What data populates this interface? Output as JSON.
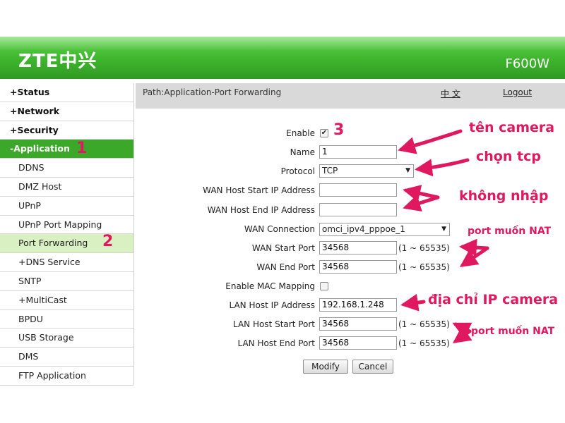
{
  "header": {
    "logo": "ZTE中兴",
    "model": "F600W"
  },
  "sidebar": {
    "items": [
      {
        "label": "+Status"
      },
      {
        "label": "+Network"
      },
      {
        "label": "+Security"
      },
      {
        "label": "-Application"
      },
      {
        "label": "DDNS"
      },
      {
        "label": "DMZ Host"
      },
      {
        "label": "UPnP"
      },
      {
        "label": "UPnP Port Mapping"
      },
      {
        "label": "Port Forwarding"
      },
      {
        "label": "+DNS Service"
      },
      {
        "label": "SNTP"
      },
      {
        "label": "+MultiCast"
      },
      {
        "label": "BPDU"
      },
      {
        "label": "USB Storage"
      },
      {
        "label": "DMS"
      },
      {
        "label": "FTP Application"
      }
    ]
  },
  "pathbar": {
    "path": "Path:Application-Port Forwarding",
    "lang": "中 文",
    "logout": "Logout"
  },
  "form": {
    "enable_label": "Enable",
    "enable_checked": "✔",
    "name_label": "Name",
    "name_value": "1",
    "protocol_label": "Protocol",
    "protocol_value": "TCP",
    "wan_start_ip_label": "WAN Host Start IP Address",
    "wan_start_ip_value": "",
    "wan_end_ip_label": "WAN Host End IP Address",
    "wan_end_ip_value": "",
    "wan_conn_label": "WAN Connection",
    "wan_conn_value": "omci_ipv4_pppoe_1",
    "wan_start_port_label": "WAN Start Port",
    "wan_start_port_value": "34568",
    "wan_end_port_label": "WAN End Port",
    "wan_end_port_value": "34568",
    "mac_label": "Enable MAC Mapping",
    "lan_ip_label": "LAN Host IP Address",
    "lan_ip_value": "192.168.1.248",
    "lan_start_port_label": "LAN Host Start Port",
    "lan_start_port_value": "34568",
    "lan_end_port_label": "LAN Host End Port",
    "lan_end_port_value": "34568",
    "range": "(1 ~ 65535)",
    "modify": "Modify",
    "cancel": "Cancel"
  },
  "annotations": {
    "step1": "1",
    "step2": "2",
    "step3": "3",
    "ten_camera": "tên camera",
    "chon_tcp": "chọn tcp",
    "khong_nhap": "không nhập",
    "port_nat_1": "port muốn NAT",
    "ip_camera": "địa chỉ IP camera",
    "port_nat_2": "port muốn NAT",
    "color": "#e0185e"
  }
}
